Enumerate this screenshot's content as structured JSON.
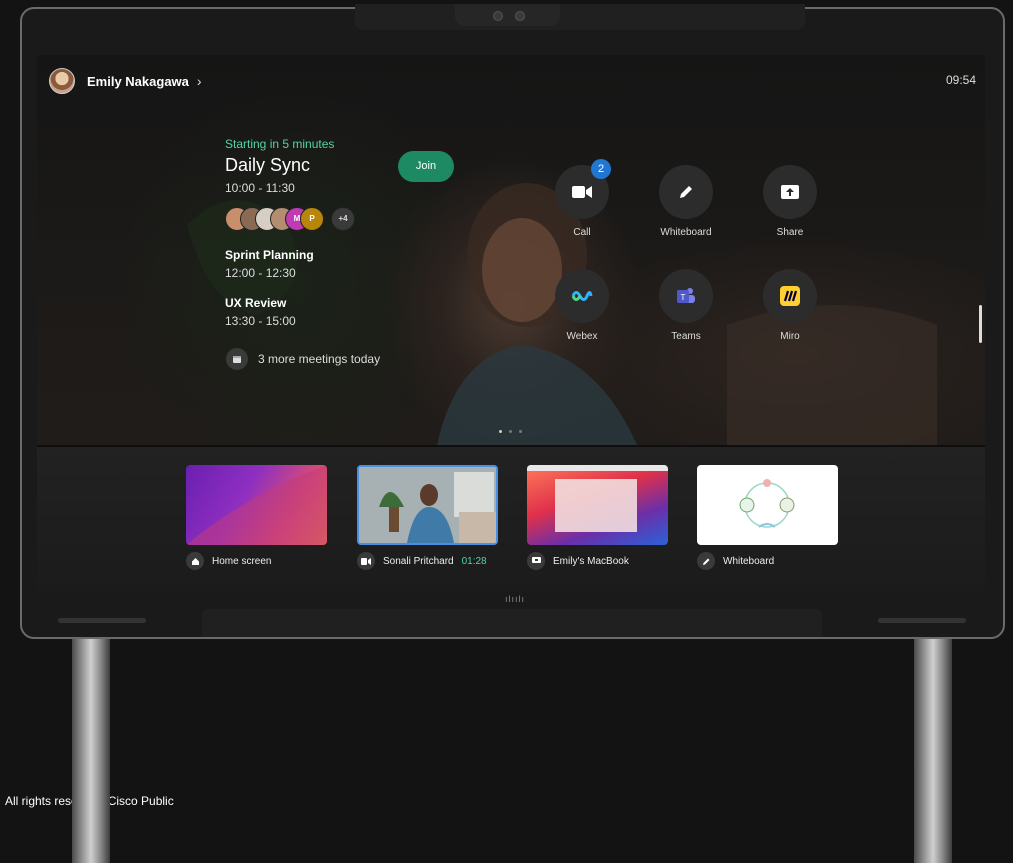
{
  "header": {
    "user_name": "Emily Nakagawa",
    "chevron": "›",
    "clock": "09:54"
  },
  "next_meeting": {
    "status": "Starting in 5 minutes",
    "title": "Daily Sync",
    "time": "10:00 - 11:30",
    "join_label": "Join",
    "participants": [
      {
        "initial": "",
        "color": "#c98e6b"
      },
      {
        "initial": "",
        "color": "#8a6a55"
      },
      {
        "initial": "",
        "color": "#d7cfc4"
      },
      {
        "initial": "",
        "color": "#b48c70"
      },
      {
        "initial": "M",
        "color": "#c03bb3"
      },
      {
        "initial": "P",
        "color": "#b8860b"
      }
    ],
    "extra_count": "+4"
  },
  "meetings": [
    {
      "title": "Sprint Planning",
      "time": "12:00 - 12:30"
    },
    {
      "title": "UX Review",
      "time": "13:30 - 15:00"
    }
  ],
  "more_meetings": "3 more meetings today",
  "apps": [
    {
      "label": "Call",
      "icon": "video-camera-icon",
      "badge": "2"
    },
    {
      "label": "Whiteboard",
      "icon": "pen-icon"
    },
    {
      "label": "Share",
      "icon": "share-screen-icon"
    },
    {
      "label": "Webex",
      "icon": "webex-logo-icon"
    },
    {
      "label": "Teams",
      "icon": "teams-logo-icon"
    },
    {
      "label": "Miro",
      "icon": "miro-logo-icon"
    }
  ],
  "tray": [
    {
      "label": "Home screen",
      "icon": "home-icon"
    },
    {
      "label": "Sonali Pritchard",
      "duration": "01:28",
      "icon": "video-camera-icon"
    },
    {
      "label": "Emily's MacBook",
      "icon": "laptop-icon"
    },
    {
      "label": "Whiteboard",
      "icon": "pen-icon"
    }
  ],
  "device": {
    "logo": "cisco-logo-icon"
  },
  "footer": {
    "copyright": "All rights reserved. Cisco Public"
  },
  "colors": {
    "accent_green": "#4fd6a5",
    "join_button": "#1e8a63",
    "badge_blue": "#2176d2"
  }
}
